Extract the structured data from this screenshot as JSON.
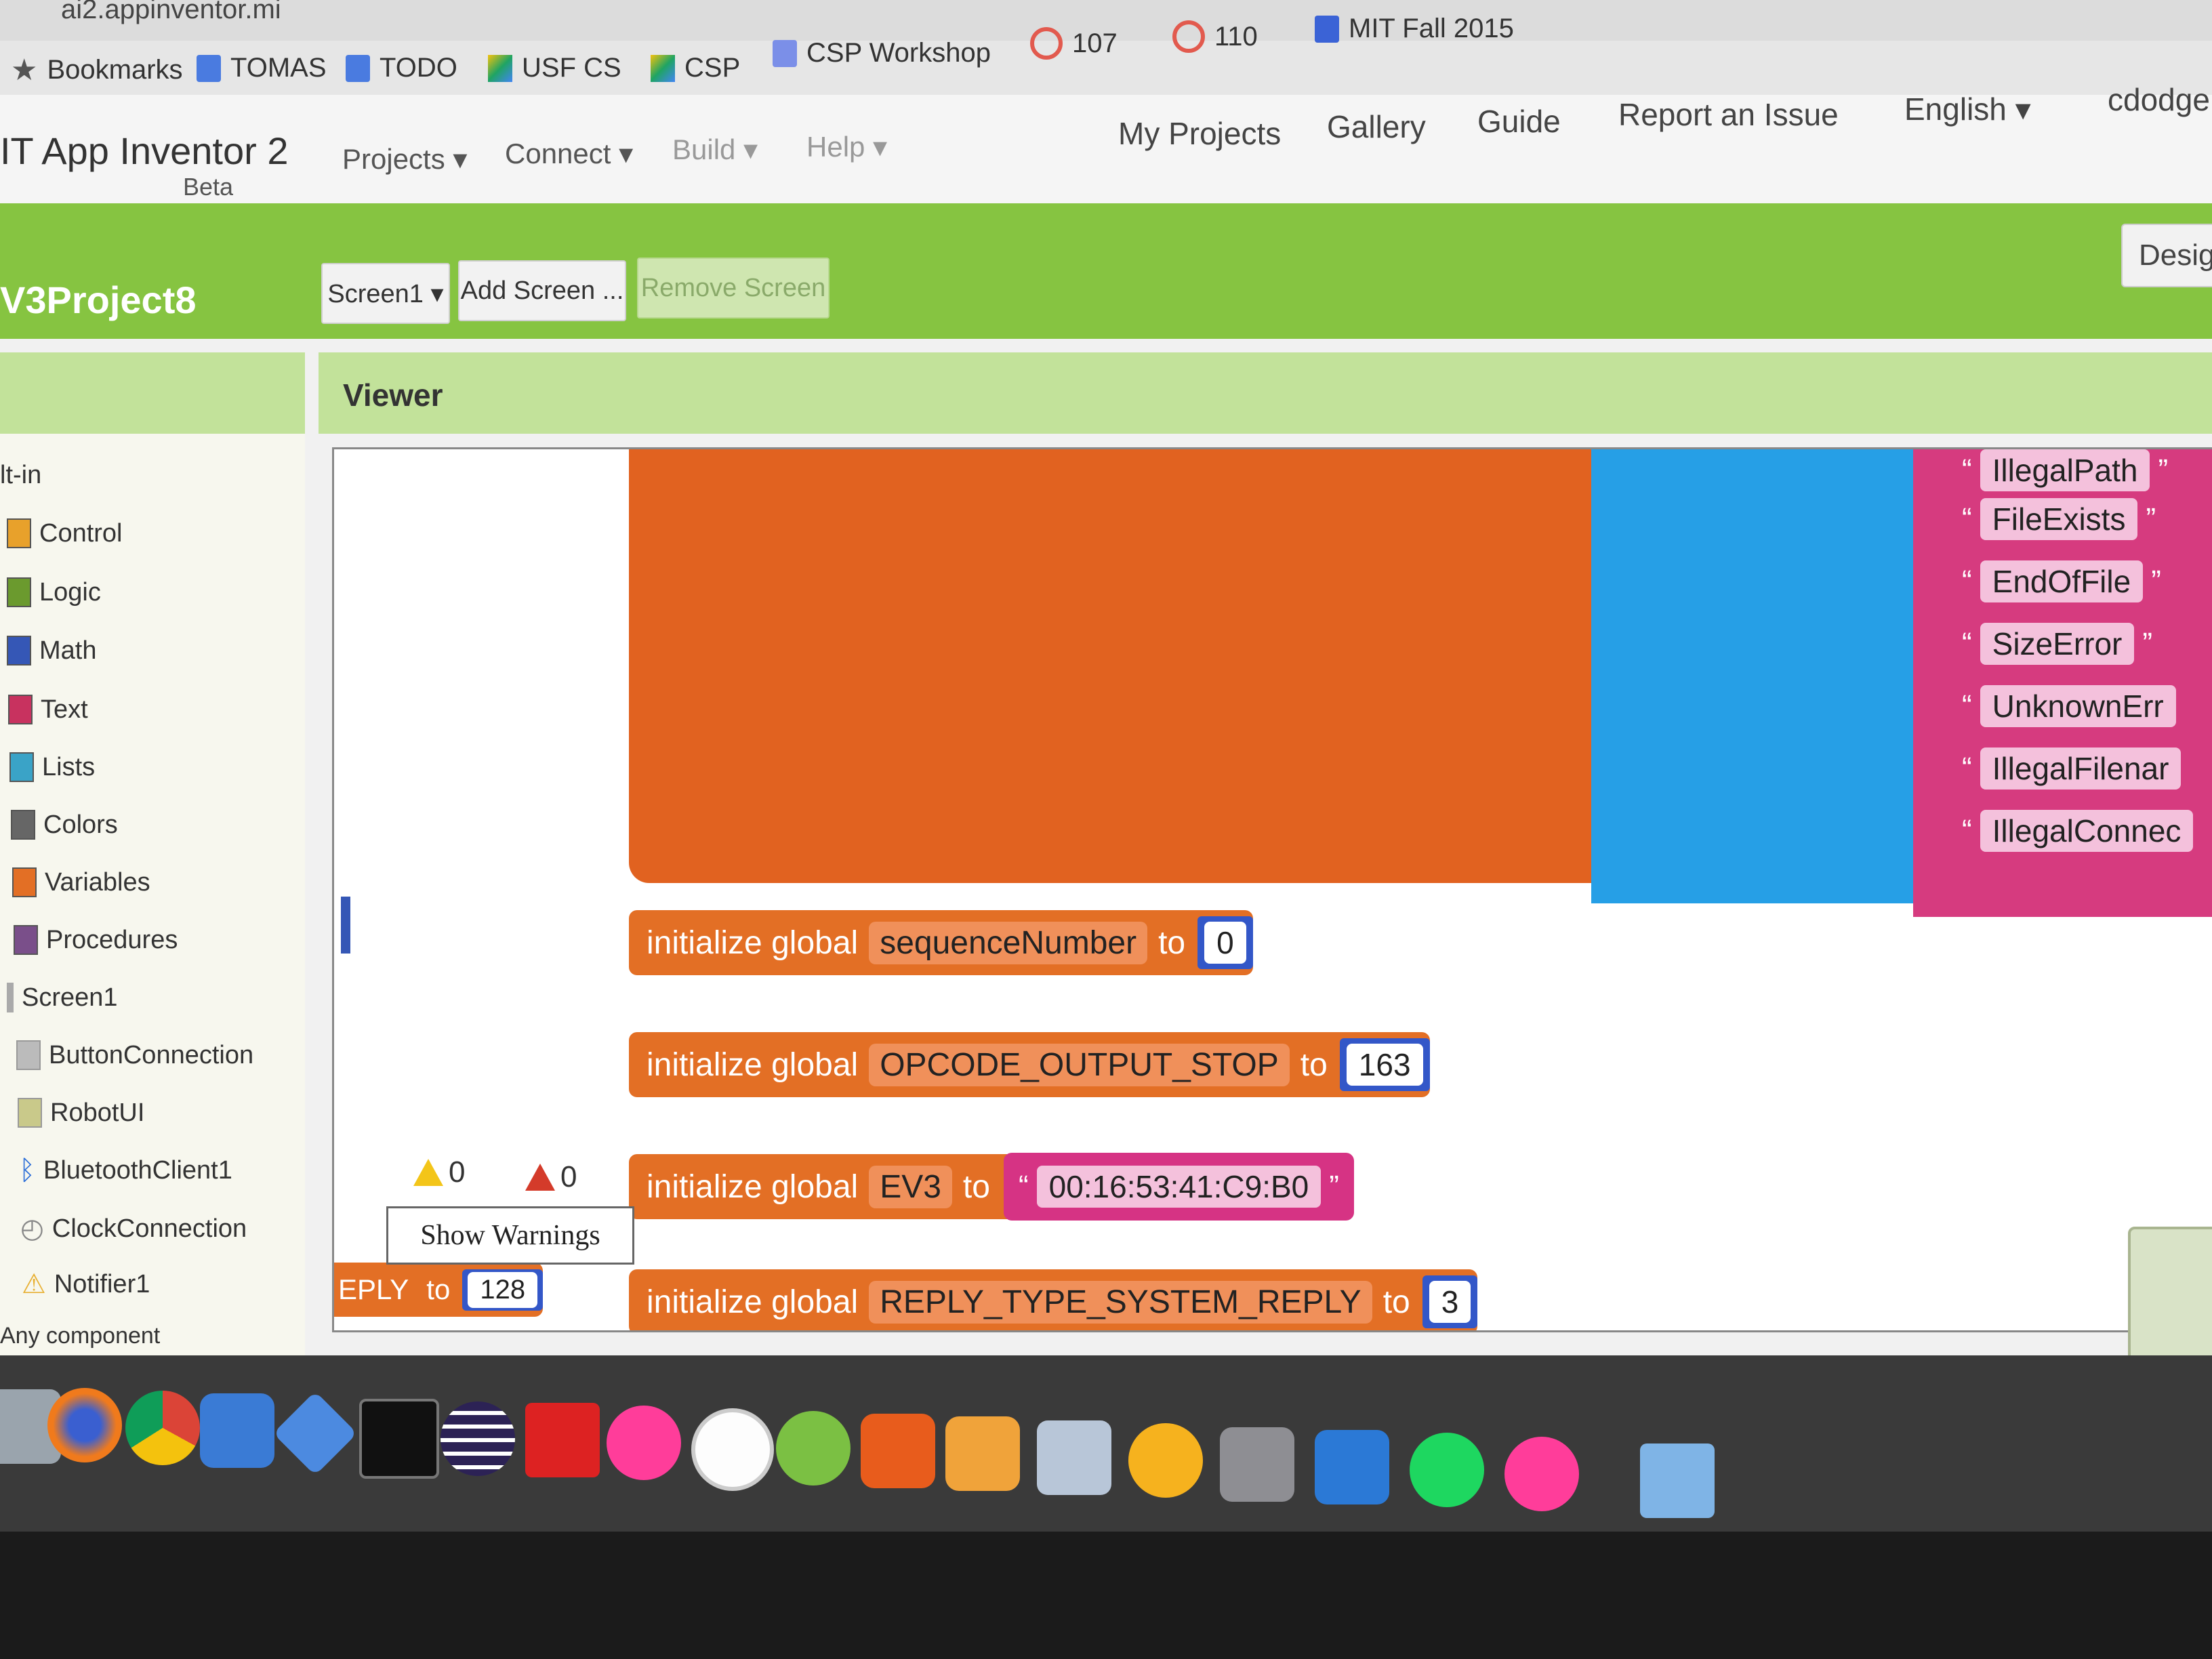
{
  "browser": {
    "url_fragment": "ai2.appinventor.mi",
    "bookmarks": [
      {
        "label": "Bookmarks",
        "icon": "star-icon"
      },
      {
        "label": "TOMAS",
        "icon": "doc-icon"
      },
      {
        "label": "TODO",
        "icon": "doc-icon"
      },
      {
        "label": "USF CS",
        "icon": "drive-icon"
      },
      {
        "label": "CSP",
        "icon": "drive-icon"
      },
      {
        "label": "CSP Workshop",
        "icon": "doc-icon"
      },
      {
        "label": "107",
        "icon": "ring-icon"
      },
      {
        "label": "110",
        "icon": "ring-icon"
      },
      {
        "label": "MIT Fall 2015",
        "icon": "calendar-icon"
      }
    ]
  },
  "app": {
    "logo": "IT App Inventor 2",
    "beta": "Beta",
    "menus": [
      "Projects ▾",
      "Connect ▾",
      "Build ▾",
      "Help ▾"
    ],
    "links": [
      "My Projects",
      "Gallery",
      "Guide",
      "Report an Issue",
      "English ▾",
      "cdodge"
    ]
  },
  "project": {
    "name": "V3Project8",
    "screen_select": "Screen1 ▾",
    "add_screen": "Add Screen ...",
    "remove_screen": "Remove Screen",
    "designer": "Desig"
  },
  "palette": {
    "builtin_label": "lt-in",
    "builtin": [
      {
        "label": "Control",
        "color": "#e8a12b"
      },
      {
        "label": "Logic",
        "color": "#6b9a2e"
      },
      {
        "label": "Math",
        "color": "#3557b6"
      },
      {
        "label": "Text",
        "color": "#c8325f"
      },
      {
        "label": "Lists",
        "color": "#3aa3c7"
      },
      {
        "label": "Colors",
        "color": "#666666"
      },
      {
        "label": "Variables",
        "color": "#e36f25"
      },
      {
        "label": "Procedures",
        "color": "#7a4f8a"
      }
    ],
    "screen_label": "Screen1",
    "components": [
      "ButtonConnection",
      "RobotUI",
      "BluetoothClient1",
      "ClockConnection",
      "Notifier1"
    ],
    "any_component": "Any component"
  },
  "viewer": {
    "title": "Viewer",
    "error_items": [
      "IllegalPath",
      "FileExists",
      "EndOfFile",
      "SizeError",
      "UnknownErr",
      "IllegalFilenar",
      "IllegalConnec"
    ],
    "blocks": [
      {
        "kw": "initialize global",
        "name": "sequenceNumber",
        "to": "to",
        "value": "0"
      },
      {
        "kw": "initialize global",
        "name": "OPCODE_OUTPUT_STOP",
        "to": "to",
        "value": "163"
      },
      {
        "kw": "initialize global",
        "name": "EV3",
        "to": "to",
        "value": "00:16:53:41:C9:B0"
      },
      {
        "kw": "initialize global",
        "name": "REPLY_TYPE_SYSTEM_REPLY",
        "to": "to",
        "value": "3"
      }
    ],
    "partial_block": {
      "name": "EPLY",
      "to": "to",
      "value": "128"
    },
    "warnings_count": "0",
    "errors_count": "0",
    "show_warnings": "Show Warnings"
  },
  "dock": {
    "icons": [
      "finder-icon",
      "firefox-icon",
      "chrome-icon",
      "app-icon",
      "app-icon",
      "terminal-icon",
      "eclipse-icon",
      "app-icon",
      "flickr-icon",
      "itunes-icon",
      "android-studio-icon",
      "powerpoint-icon",
      "app-icon",
      "preview-icon",
      "ibooks-icon",
      "system-preferences-icon",
      "word-icon",
      "spotify-icon",
      "flickr-icon",
      "folder-icon"
    ]
  }
}
